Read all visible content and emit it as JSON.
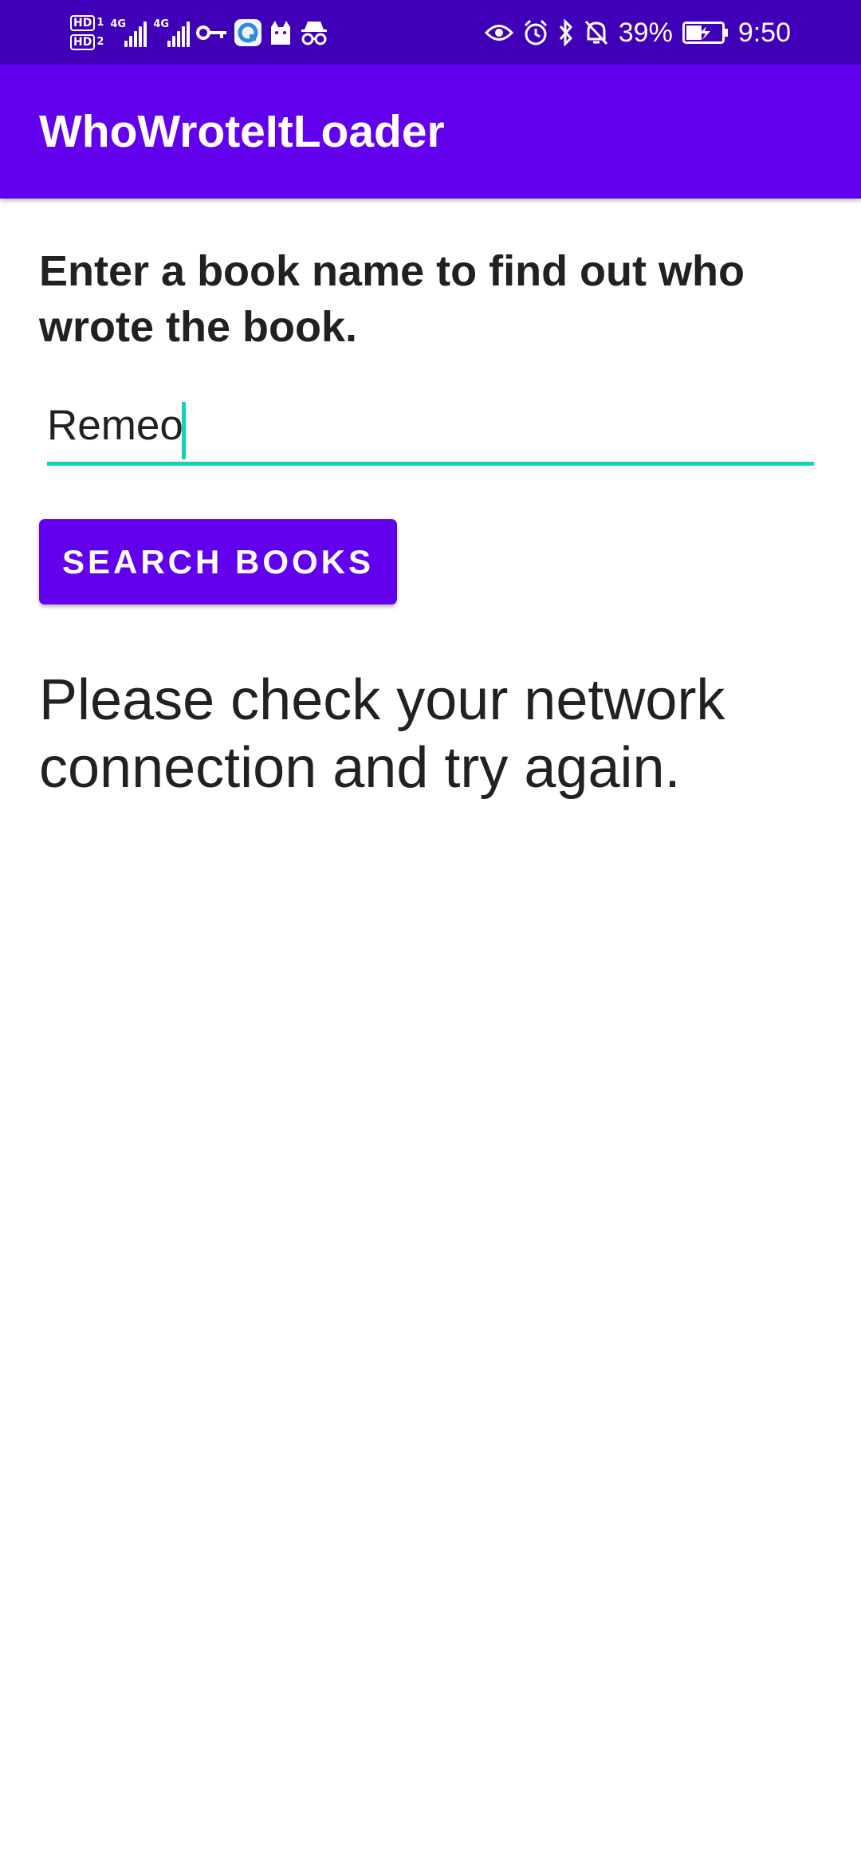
{
  "status_bar": {
    "sim1_label": "HD",
    "sim1_num": "1",
    "sim2_label": "HD",
    "sim2_num": "2",
    "network_1": "4G",
    "network_2": "4G",
    "battery_percent": "39%",
    "time": "9:50",
    "left_icons": [
      "vpn-key-icon",
      "browser-app-icon",
      "cat-app-icon",
      "incognito-icon"
    ],
    "right_icons": [
      "eye-icon",
      "alarm-icon",
      "bluetooth-icon",
      "bell-off-icon",
      "battery-charging-icon"
    ]
  },
  "app_bar": {
    "title": "WhoWroteItLoader",
    "color": "#6200ee"
  },
  "content": {
    "instructions": "Enter a book name to find out who wrote the book.",
    "book_input_value": "Remeo",
    "search_button_label": "SEARCH BOOKS",
    "result_text": "Please check your network connection and try again."
  },
  "colors": {
    "status_bar": "#4000b8",
    "accent": "#14d1b7",
    "primary": "#6200ee"
  }
}
